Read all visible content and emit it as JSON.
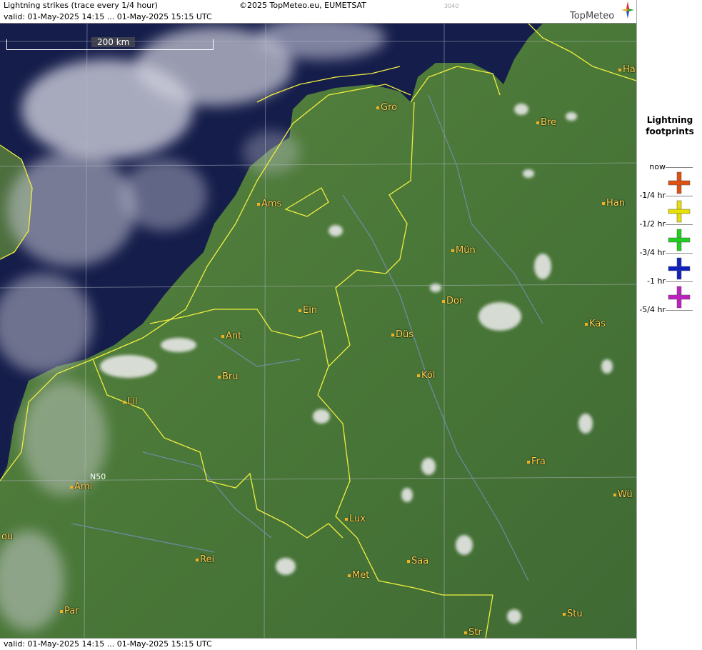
{
  "header": {
    "title": "Lightning strikes (trace every 1/4 hour)",
    "copyright": "©2025 TopMeteo.eu, EUMETSAT",
    "id_code": "3040",
    "valid": "valid:  01-May-2025 14:15 ... 01-May-2025 15:15 UTC"
  },
  "footer": {
    "valid": "valid:  01-May-2025 14:15 ... 01-May-2025 15:15 UTC"
  },
  "logo": {
    "text": "TopMeteo"
  },
  "scale": {
    "label": "200 km"
  },
  "grid": {
    "label": "N50"
  },
  "cities": [
    {
      "key": "gro",
      "name": "Gro"
    },
    {
      "key": "bre",
      "name": "Bre"
    },
    {
      "key": "ha",
      "name": "Ha"
    },
    {
      "key": "ams",
      "name": "Ams"
    },
    {
      "key": "han",
      "name": "Han"
    },
    {
      "key": "mun",
      "name": "Mün"
    },
    {
      "key": "dor",
      "name": "Dor"
    },
    {
      "key": "ein",
      "name": "Ein"
    },
    {
      "key": "ant",
      "name": "Ant"
    },
    {
      "key": "dus",
      "name": "Düs"
    },
    {
      "key": "kas",
      "name": "Kas"
    },
    {
      "key": "bru",
      "name": "Bru"
    },
    {
      "key": "kol",
      "name": "Köl"
    },
    {
      "key": "lil",
      "name": "Lil"
    },
    {
      "key": "fra",
      "name": "Fra"
    },
    {
      "key": "ami",
      "name": "Ami"
    },
    {
      "key": "wu",
      "name": "Wü"
    },
    {
      "key": "lux",
      "name": "Lux"
    },
    {
      "key": "ou",
      "name": "ou"
    },
    {
      "key": "rei",
      "name": "Rei"
    },
    {
      "key": "saa",
      "name": "Saa"
    },
    {
      "key": "met",
      "name": "Met"
    },
    {
      "key": "par",
      "name": "Par"
    },
    {
      "key": "stu",
      "name": "Stu"
    },
    {
      "key": "str",
      "name": "Str"
    }
  ],
  "legend": {
    "title_line1": "Lightning",
    "title_line2": "footprints",
    "items": [
      {
        "label": "now",
        "color": "#e05010"
      },
      {
        "label": "-1/4 hr",
        "color": "#e8e000"
      },
      {
        "label": "-1/2 hr",
        "color": "#20d020"
      },
      {
        "label": "-3/4 hr",
        "color": "#1020c0"
      },
      {
        "label": "-1 hr",
        "color": "#c020c0"
      },
      {
        "label": "-5/4 hr",
        "color": ""
      }
    ]
  },
  "colors": {
    "sea": "#141c48",
    "land": "#4d7a3a",
    "border": "#f0ee40",
    "city_label": "#ffd34d"
  }
}
